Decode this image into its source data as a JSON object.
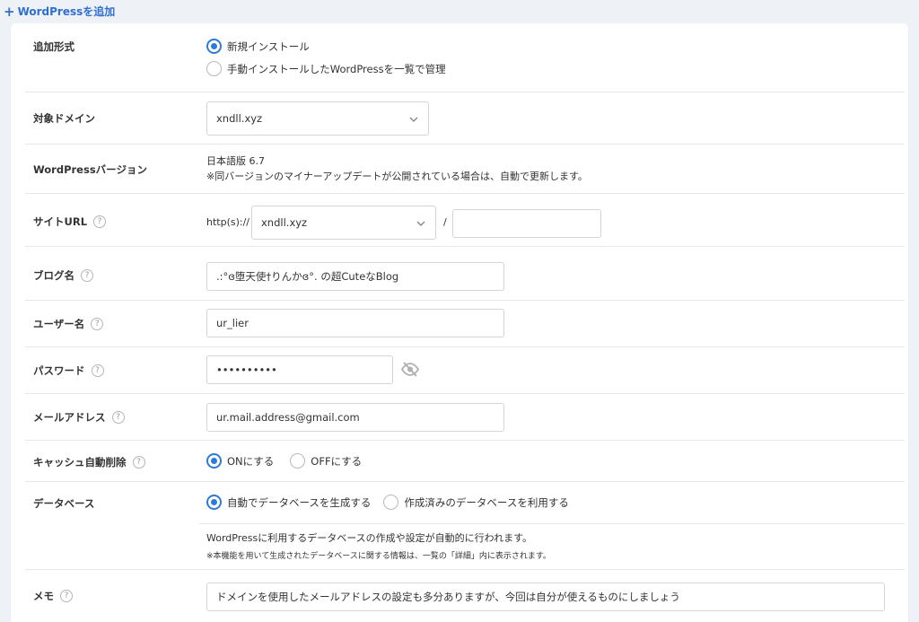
{
  "header": {
    "add_icon": "plus-icon",
    "add_label": "WordPressを追加"
  },
  "form": {
    "install_type": {
      "label": "追加形式",
      "options": [
        "新規インストール",
        "手動インストールしたWordPressを一覧で管理"
      ],
      "selected": 0
    },
    "domain": {
      "label": "対象ドメイン",
      "value": "xndll.xyz"
    },
    "version": {
      "label": "WordPressバージョン",
      "value": "日本語版 6.7",
      "note": "※同バージョンのマイナーアップデートが公開されている場合は、自動で更新します。"
    },
    "site_url": {
      "label": "サイトURL",
      "prefix": "http(s)://",
      "domain": "xndll.xyz",
      "slash": "/",
      "path": ""
    },
    "blog_name": {
      "label": "ブログ名",
      "value": ".:°ɞ堕天使†りんかɞ°. の超CuteなBlog"
    },
    "username": {
      "label": "ユーザー名",
      "value": "ur_lier"
    },
    "password": {
      "label": "パスワード",
      "value": "••••••••••",
      "toggle_icon": "eye-slash-icon"
    },
    "email": {
      "label": "メールアドレス",
      "value": "ur.mail.address@gmail.com"
    },
    "cache": {
      "label": "キャッシュ自動削除",
      "options": [
        "ONにする",
        "OFFにする"
      ],
      "selected": 0
    },
    "database": {
      "label": "データベース",
      "options": [
        "自動でデータベースを生成する",
        "作成済みのデータベースを利用する"
      ],
      "selected": 0,
      "info": "WordPressに利用するデータベースの作成や設定が自動的に行われます。",
      "note": "※本機能を用いて生成されたデータベースに関する情報は、一覧の「詳細」内に表示されます。"
    },
    "memo": {
      "label": "メモ",
      "value": "ドメインを使用したメールアドレスの設定も多分ありますが、今回は自分が使えるものにしましょう"
    },
    "help_mark": "?"
  },
  "colors": {
    "accent": "#2f7ad8",
    "link": "#2f6fd0",
    "background": "#eef2f7"
  }
}
